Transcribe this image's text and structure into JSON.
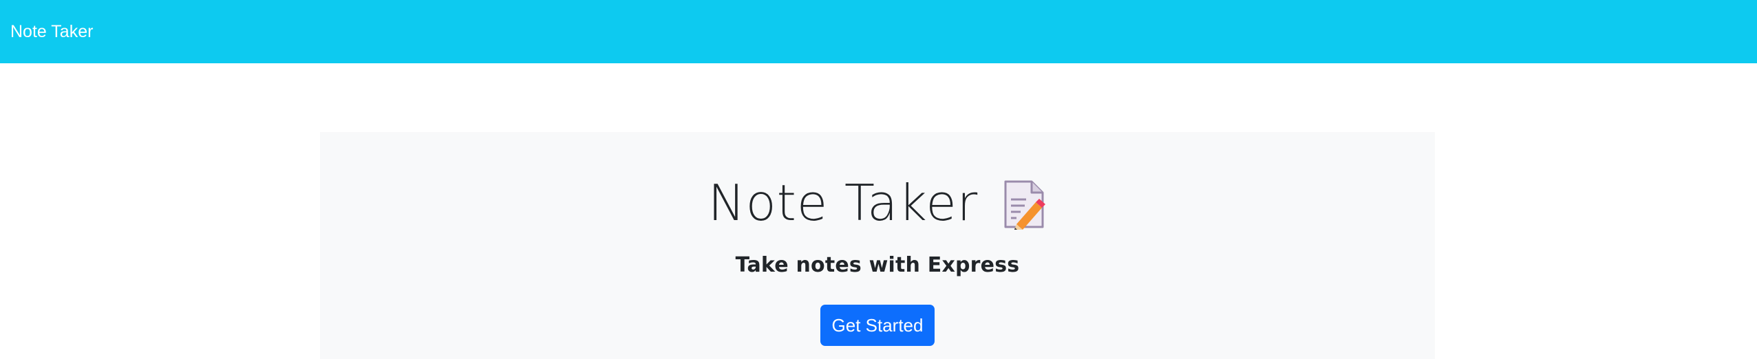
{
  "navbar": {
    "brand": "Note Taker",
    "background_color": "#0dcaf0"
  },
  "hero": {
    "title": "Note Taker",
    "icon": "memo-icon",
    "subtitle": "Take notes with Express",
    "button_label": "Get Started",
    "button_color": "#0d6efd",
    "background_color": "#f8f9fa"
  }
}
